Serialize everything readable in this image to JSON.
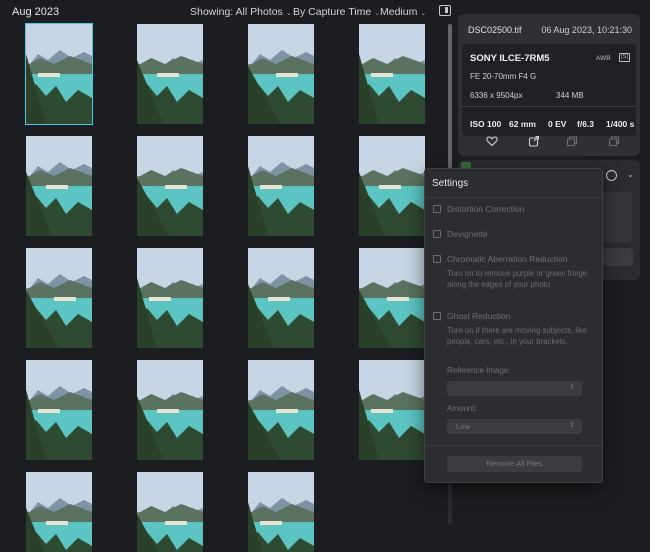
{
  "toolbar": {
    "date": "Aug 2023",
    "filter": "Showing: All Photos",
    "sort": "By Capture Time",
    "size": "Medium"
  },
  "info": {
    "filename": "DSC02500.tif",
    "timestamp": "06 Aug 2023, 10:21:30",
    "camera": "SONY ILCE-7RM5",
    "awb": "AWB",
    "awb_icon_text": "[S]",
    "lens": "FE 20-70mm F4 G",
    "resolution": "6336 x 9504px",
    "filesize": "344 MB",
    "exposure": [
      "ISO 100",
      "62 mm",
      "0 EV",
      "f/6.3",
      "1/400 s"
    ]
  },
  "settings": {
    "title": "Settings",
    "distortion": "Distortion Correction",
    "devignette": "Devignette",
    "chromatic": "Chromatic Aberration Reduction",
    "chromatic_desc": "Turn on to remove purple or green fringe along the edges of your photo",
    "ghost": "Ghost Reduction",
    "ghost_desc": "Turn on if there are moving subjects, like people, cars, etc., in your brackets.",
    "reference_label": "Reference Image:",
    "reference_value": "",
    "amount_label": "Amount:",
    "amount_value": "Low",
    "remove": "Remove All Files"
  },
  "icons": {
    "panel": "panel-toggle-icon",
    "heart": "heart-icon",
    "share": "share-icon",
    "copy": "copy-icon",
    "stack": "stack-icon"
  }
}
